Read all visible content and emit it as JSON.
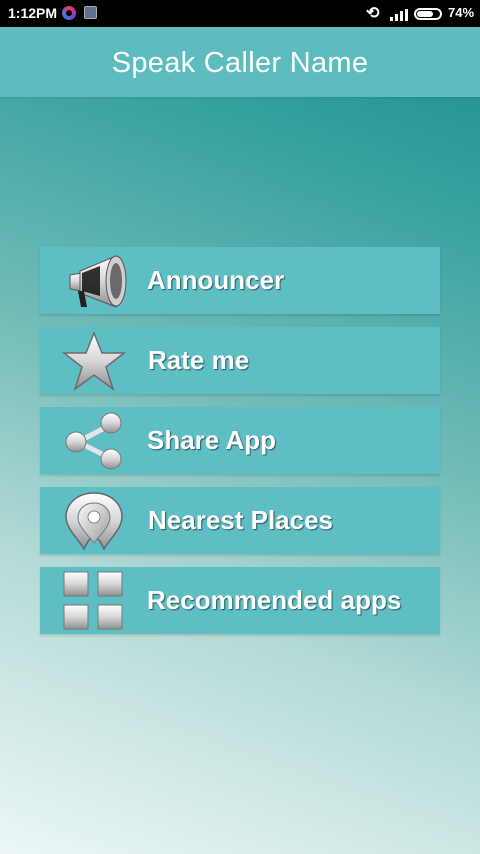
{
  "status_bar": {
    "time": "1:12PM",
    "battery_percent": "74%",
    "battery_level": 0.74,
    "icons": [
      "notification-app-icon",
      "notification-app-icon-2",
      "sync-off-icon",
      "signal-icon",
      "battery-icon"
    ]
  },
  "app_bar": {
    "title": "Speak Caller Name"
  },
  "menu": {
    "items": [
      {
        "label": "Announcer",
        "icon": "megaphone-icon"
      },
      {
        "label": "Rate me",
        "icon": "star-icon"
      },
      {
        "label": "Share App",
        "icon": "share-icon"
      },
      {
        "label": "Nearest Places",
        "icon": "location-pin-icon"
      },
      {
        "label": "Recommended apps",
        "icon": "grid-icon"
      }
    ]
  },
  "colors": {
    "app_bar": "#5cbcc0",
    "menu_item": "#5dbfc4",
    "text": "#ffffff"
  }
}
